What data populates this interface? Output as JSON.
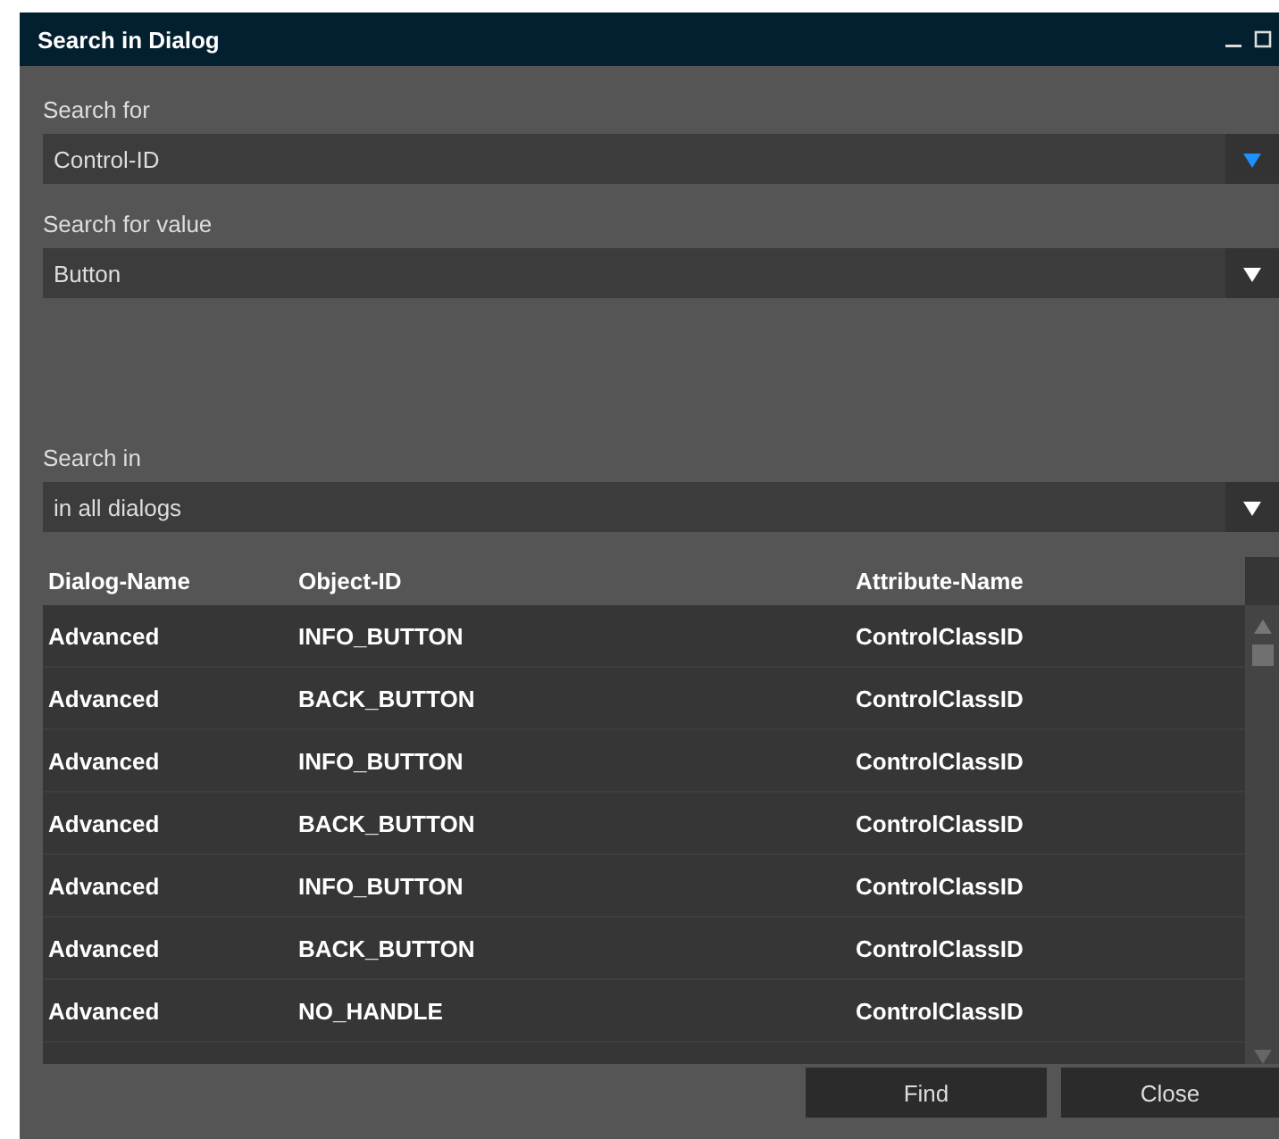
{
  "window": {
    "title": "Search in Dialog"
  },
  "fields": [
    {
      "label": "Search for",
      "value": "Control-ID",
      "focused": true
    },
    {
      "label": "Search for value",
      "value": "Button",
      "focused": false
    },
    {
      "label": "Search in",
      "value": "in all dialogs",
      "focused": false
    }
  ],
  "table": {
    "columns": [
      "Dialog-Name",
      "Object-ID",
      "Attribute-Name"
    ],
    "rows": [
      [
        "Advanced",
        "INFO_BUTTON",
        "ControlClassID"
      ],
      [
        "Advanced",
        "BACK_BUTTON",
        "ControlClassID"
      ],
      [
        "Advanced",
        "INFO_BUTTON",
        "ControlClassID"
      ],
      [
        "Advanced",
        "BACK_BUTTON",
        "ControlClassID"
      ],
      [
        "Advanced",
        "INFO_BUTTON",
        "ControlClassID"
      ],
      [
        "Advanced",
        "BACK_BUTTON",
        "ControlClassID"
      ],
      [
        "Advanced",
        "NO_HANDLE",
        "ControlClassID"
      ]
    ]
  },
  "buttons": [
    "Find",
    "Close"
  ]
}
